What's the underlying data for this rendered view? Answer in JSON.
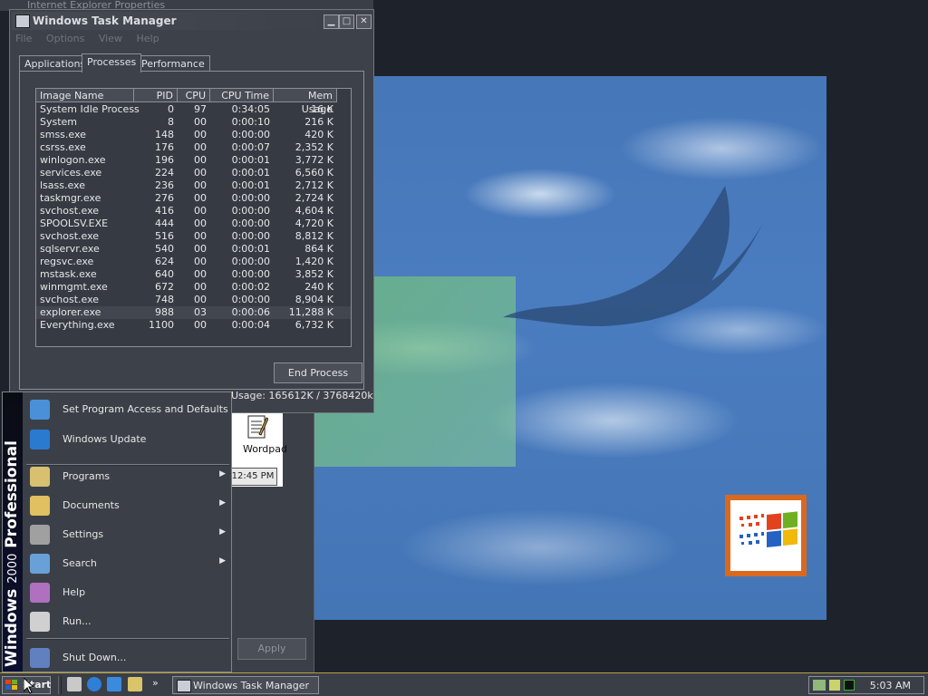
{
  "taskmgr": {
    "title": "Windows Task Manager",
    "menu": [
      "File",
      "Options",
      "View",
      "Help"
    ],
    "tabs": [
      "Applications",
      "Processes",
      "Performance"
    ],
    "active_tab": "Processes",
    "columns": [
      "Image Name",
      "PID",
      "CPU",
      "CPU Time",
      "Mem Usage"
    ],
    "processes": [
      {
        "name": "System Idle Process",
        "pid": "0",
        "cpu": "97",
        "time": "0:34:05",
        "mem": "16 K"
      },
      {
        "name": "System",
        "pid": "8",
        "cpu": "00",
        "time": "0:00:10",
        "mem": "216 K"
      },
      {
        "name": "smss.exe",
        "pid": "148",
        "cpu": "00",
        "time": "0:00:00",
        "mem": "420 K"
      },
      {
        "name": "csrss.exe",
        "pid": "176",
        "cpu": "00",
        "time": "0:00:07",
        "mem": "2,352 K"
      },
      {
        "name": "winlogon.exe",
        "pid": "196",
        "cpu": "00",
        "time": "0:00:01",
        "mem": "3,772 K"
      },
      {
        "name": "services.exe",
        "pid": "224",
        "cpu": "00",
        "time": "0:00:01",
        "mem": "6,560 K"
      },
      {
        "name": "lsass.exe",
        "pid": "236",
        "cpu": "00",
        "time": "0:00:01",
        "mem": "2,712 K"
      },
      {
        "name": "taskmgr.exe",
        "pid": "276",
        "cpu": "00",
        "time": "0:00:00",
        "mem": "2,724 K"
      },
      {
        "name": "svchost.exe",
        "pid": "416",
        "cpu": "00",
        "time": "0:00:00",
        "mem": "4,604 K"
      },
      {
        "name": "SPOOLSV.EXE",
        "pid": "444",
        "cpu": "00",
        "time": "0:00:00",
        "mem": "4,720 K"
      },
      {
        "name": "svchost.exe",
        "pid": "516",
        "cpu": "00",
        "time": "0:00:00",
        "mem": "8,812 K"
      },
      {
        "name": "sqlservr.exe",
        "pid": "540",
        "cpu": "00",
        "time": "0:00:01",
        "mem": "864 K"
      },
      {
        "name": "regsvc.exe",
        "pid": "624",
        "cpu": "00",
        "time": "0:00:00",
        "mem": "1,420 K"
      },
      {
        "name": "mstask.exe",
        "pid": "640",
        "cpu": "00",
        "time": "0:00:00",
        "mem": "3,852 K"
      },
      {
        "name": "winmgmt.exe",
        "pid": "672",
        "cpu": "00",
        "time": "0:00:02",
        "mem": "240 K"
      },
      {
        "name": "svchost.exe",
        "pid": "748",
        "cpu": "00",
        "time": "0:00:00",
        "mem": "8,904 K"
      },
      {
        "name": "explorer.exe",
        "pid": "988",
        "cpu": "03",
        "time": "0:00:06",
        "mem": "11,288 K"
      },
      {
        "name": "Everything.exe",
        "pid": "1100",
        "cpu": "00",
        "time": "0:00:04",
        "mem": "6,732 K"
      }
    ],
    "end_process_label": "End Process",
    "status_mem": "Usage: 165612K / 3768420k"
  },
  "start_menu": {
    "banner_brand": "Windows",
    "banner_version": "2000",
    "banner_edition": "Professional",
    "items": [
      {
        "label": "Set Program Access and Defaults",
        "icon": "program-access-icon",
        "submenu": false
      },
      {
        "label": "Windows Update",
        "icon": "windows-update-icon",
        "submenu": false
      },
      {
        "label": "Programs",
        "icon": "programs-icon",
        "submenu": true
      },
      {
        "label": "Documents",
        "icon": "documents-icon",
        "submenu": true
      },
      {
        "label": "Settings",
        "icon": "settings-icon",
        "submenu": true
      },
      {
        "label": "Search",
        "icon": "search-icon",
        "submenu": true
      },
      {
        "label": "Help",
        "icon": "help-icon",
        "submenu": false
      },
      {
        "label": "Run...",
        "icon": "run-icon",
        "submenu": false
      },
      {
        "label": "Shut Down...",
        "icon": "shutdown-icon",
        "submenu": false
      }
    ]
  },
  "desktop": {
    "wordpad_label": "Wordpad",
    "wordpad_time": "12:45 PM",
    "apply_label": "Apply",
    "background_window_title": "Internet Explorer Properties"
  },
  "taskbar": {
    "start_label": "Start",
    "task_label": "Windows Task Manager",
    "clock": "5:03 AM",
    "quicklaunch": [
      "show-desktop-icon",
      "internet-explorer-icon",
      "outlook-express-icon",
      "explorer-icon"
    ]
  },
  "colors": {
    "desktop_bg": "#1e232b",
    "window_bg": "#3c414a",
    "wallpaper_blue": "#4677b8",
    "logo_orange": "#d9691f"
  }
}
